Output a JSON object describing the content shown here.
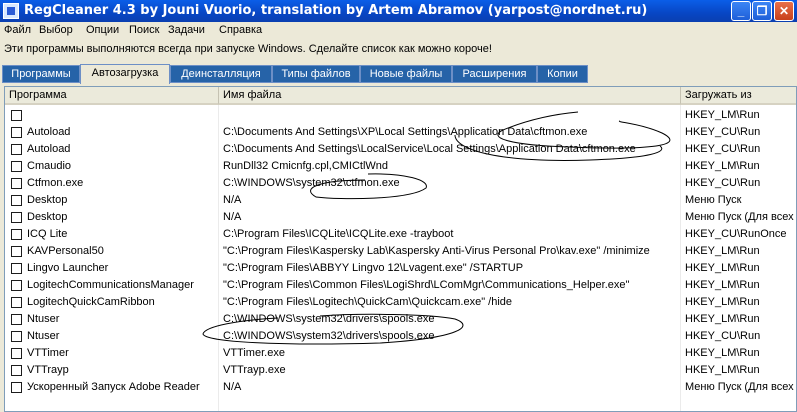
{
  "window": {
    "title": "RegCleaner 4.3 by Jouni Vuorio, translation by Artem Abramov (yarpost@nordnet.ru)",
    "icon": "regcleaner-app-icon",
    "minimize_glyph": "_",
    "restore_glyph": "❐",
    "close_glyph": "✕"
  },
  "menu": [
    "Файл",
    "Выбор",
    "Опции",
    "Поиск",
    "Задачи",
    "Справка"
  ],
  "message": "Эти программы выполняются всегда при запуске Windows. Сделайте список как можно короче!",
  "tabs": [
    {
      "label": "Программы"
    },
    {
      "label": "Автозагрузка",
      "active": true
    },
    {
      "label": "Деинсталляция"
    },
    {
      "label": "Типы файлов"
    },
    {
      "label": "Новые файлы"
    },
    {
      "label": "Расширения"
    },
    {
      "label": "Копии"
    }
  ],
  "table": {
    "columns": [
      "Программа",
      "Имя файла",
      "Загружать из"
    ],
    "rows": [
      {
        "program": "",
        "file": "",
        "source": "HKEY_LM\\Run"
      },
      {
        "program": "Autoload",
        "file": "C:\\Documents And Settings\\XP\\Local Settings\\Application Data\\cftmon.exe",
        "source": "HKEY_CU\\Run"
      },
      {
        "program": "Autoload",
        "file": "C:\\Documents And Settings\\LocalService\\Local Settings\\Application Data\\cftmon.exe",
        "source": "HKEY_CU\\Run"
      },
      {
        "program": "Cmaudio",
        "file": "RunDll32 Cmicnfg.cpl,CMICtlWnd",
        "source": "HKEY_LM\\Run"
      },
      {
        "program": "Ctfmon.exe",
        "file": "C:\\WINDOWS\\system32\\ctfmon.exe",
        "source": "HKEY_CU\\Run"
      },
      {
        "program": "Desktop",
        "file": "N/A",
        "source": "Меню Пуск"
      },
      {
        "program": "Desktop",
        "file": "N/A",
        "source": "Меню Пуск (Для всех"
      },
      {
        "program": "ICQ Lite",
        "file": "C:\\Program Files\\ICQLite\\ICQLite.exe -trayboot",
        "source": "HKEY_CU\\RunOnce"
      },
      {
        "program": "KAVPersonal50",
        "file": "\"C:\\Program Files\\Kaspersky Lab\\Kaspersky Anti-Virus Personal Pro\\kav.exe\" /minimize",
        "source": "HKEY_LM\\Run"
      },
      {
        "program": "Lingvo Launcher",
        "file": "\"C:\\Program Files\\ABBYY Lingvo 12\\Lvagent.exe\" /STARTUP",
        "source": "HKEY_LM\\Run"
      },
      {
        "program": "LogitechCommunicationsManager",
        "file": "\"C:\\Program Files\\Common Files\\LogiShrd\\LComMgr\\Communications_Helper.exe\"",
        "source": "HKEY_LM\\Run"
      },
      {
        "program": "LogitechQuickCamRibbon",
        "file": "\"C:\\Program Files\\Logitech\\QuickCam\\Quickcam.exe\" /hide",
        "source": "HKEY_LM\\Run"
      },
      {
        "program": "Ntuser",
        "file": "C:\\WINDOWS\\system32\\drivers\\spools.exe",
        "source": "HKEY_LM\\Run"
      },
      {
        "program": "Ntuser",
        "file": "C:\\WINDOWS\\system32\\drivers\\spools.exe",
        "source": "HKEY_CU\\Run"
      },
      {
        "program": "VTTimer",
        "file": "VTTimer.exe",
        "source": "HKEY_LM\\Run"
      },
      {
        "program": "VTTrayp",
        "file": "VTTrayp.exe",
        "source": "HKEY_LM\\Run"
      },
      {
        "program": "Ускоренный Запуск Adobe Reader",
        "file": "N/A",
        "source": "Меню Пуск (Для всех"
      }
    ]
  }
}
